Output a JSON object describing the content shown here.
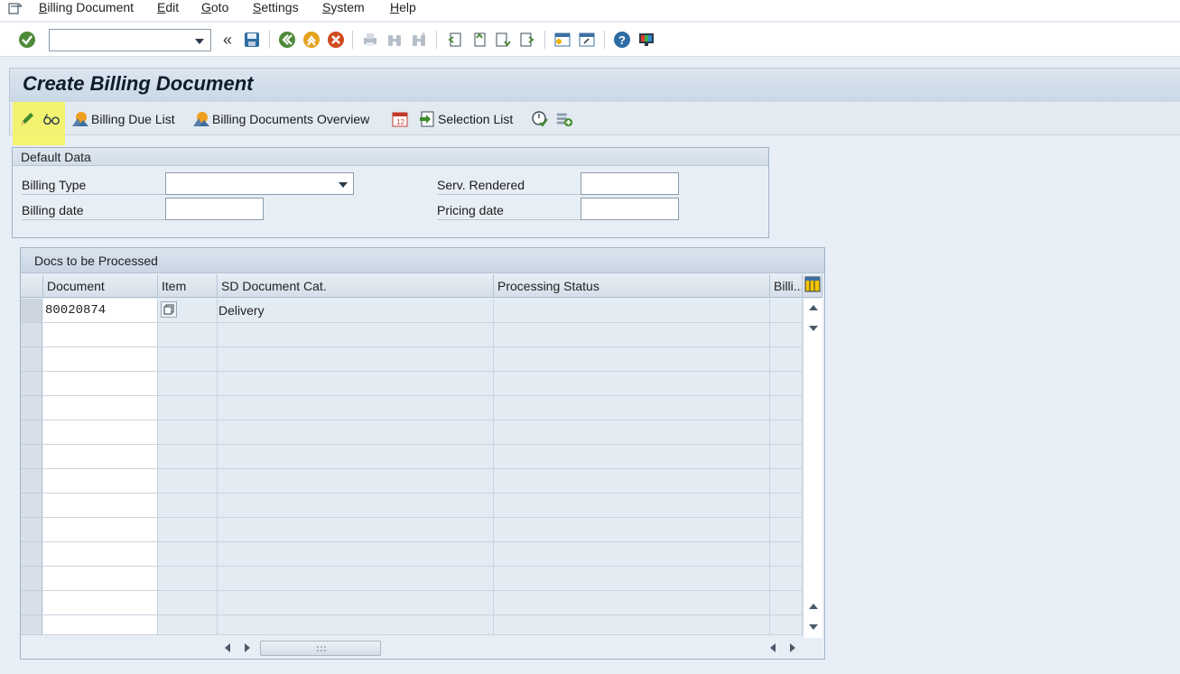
{
  "menubar": {
    "items": [
      {
        "mnemonic": "B",
        "rest": "illing Document"
      },
      {
        "mnemonic": "E",
        "rest": "dit"
      },
      {
        "mnemonic": "G",
        "rest": "oto"
      },
      {
        "mnemonic": "S",
        "rest": "ettings"
      },
      {
        "mnemonic": "S",
        "rest": "ystem"
      },
      {
        "mnemonic": "H",
        "rest": "elp"
      }
    ]
  },
  "system_toolbar": {
    "command_field_value": "",
    "collapse_glyph": "«"
  },
  "title": "Create Billing Document",
  "app_toolbar": {
    "billing_due_list": "Billing Due List",
    "billing_docs_overview": "Billing Documents Overview",
    "selection_list": "Selection List"
  },
  "default_data": {
    "header": "Default Data",
    "billing_type_label": "Billing Type",
    "billing_type_value": "",
    "billing_date_label": "Billing date",
    "billing_date_value": "",
    "serv_rendered_label": "Serv. Rendered",
    "serv_rendered_value": "",
    "pricing_date_label": "Pricing date",
    "pricing_date_value": ""
  },
  "docs_table": {
    "title": "Docs to be Processed",
    "columns": [
      "Document",
      "Item",
      "SD Document Cat.",
      "Processing Status",
      "Billi..."
    ],
    "rows": [
      {
        "document": "80020874",
        "item": "",
        "sd_doc_cat": "Delivery",
        "status": "",
        "billing": ""
      }
    ]
  },
  "colors": {
    "highlight": "#f3f55a",
    "background": "#e8eef5",
    "title_text": "#0d1c2b"
  }
}
